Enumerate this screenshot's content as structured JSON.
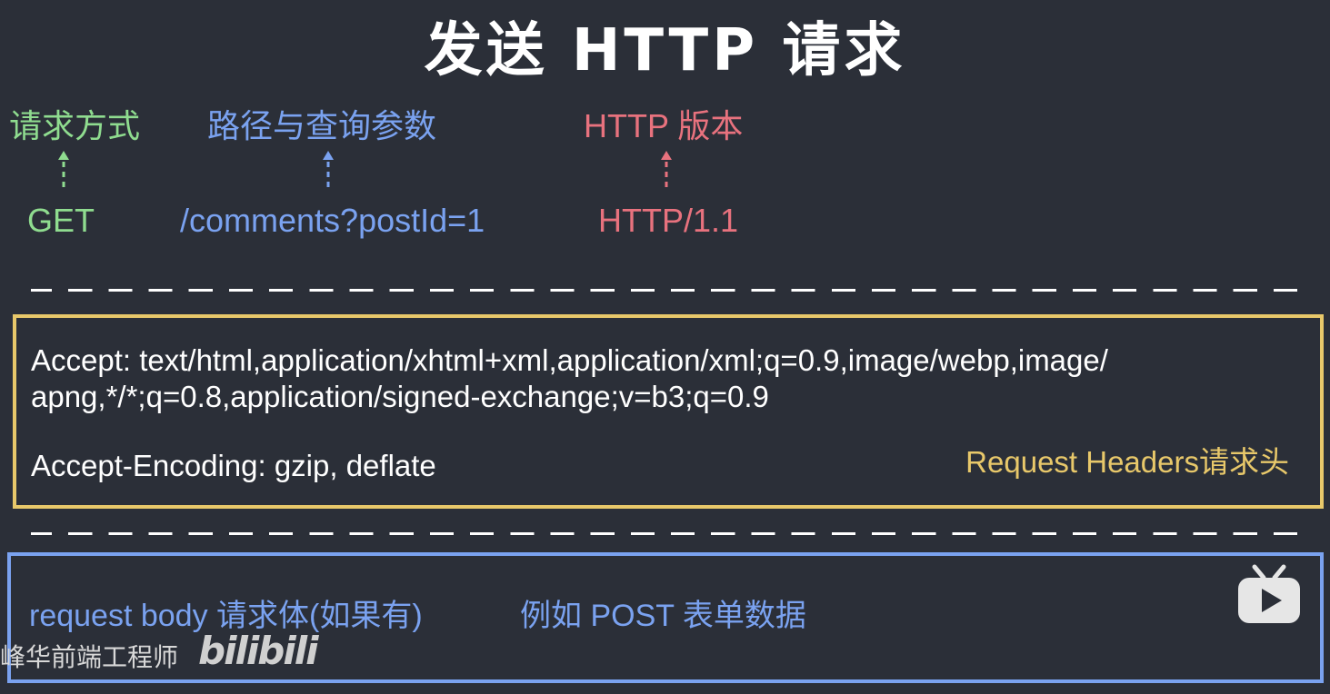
{
  "title": "发送 HTTP 请求",
  "request_line": {
    "method": {
      "label": "请求方式",
      "value": "GET",
      "color": "#8fdc8f"
    },
    "path": {
      "label": "路径与查询参数",
      "value": "/comments?postId=1",
      "color": "#7aa2f0"
    },
    "version": {
      "label": "HTTP 版本",
      "value": "HTTP/1.1",
      "color": "#e8727e"
    }
  },
  "headers": {
    "lines": [
      "Accept: text/html,application/xhtml+xml,application/xml;q=0.9,image/webp,image/",
      "apng,*/*;q=0.8,application/signed-exchange;v=b3;q=0.9",
      "Accept-Encoding: gzip, deflate"
    ],
    "caption": "Request Headers请求头",
    "border_color": "#e8c86a"
  },
  "body": {
    "label": "request body 请求体(如果有)",
    "example": "例如 POST 表单数据",
    "border_color": "#7aa2f0"
  },
  "watermark": {
    "channel": "峰华前端工程师",
    "logo": "bilibili",
    "icon": "bilibili-tv-icon"
  }
}
